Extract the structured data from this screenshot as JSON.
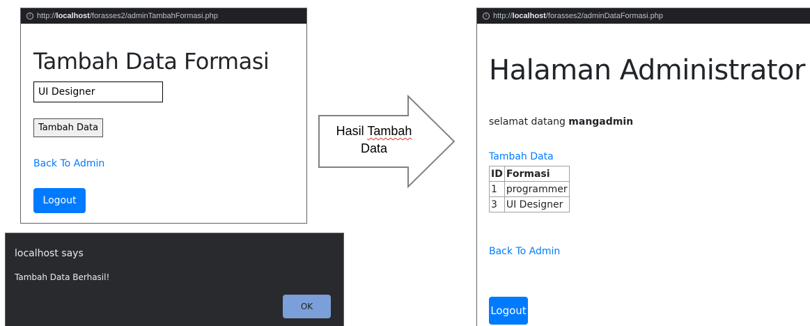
{
  "left_window": {
    "url_prefix": "http://",
    "url_host": "localhost",
    "url_path": "/forasses2/adminTambahFormasi.php",
    "heading": "Tambah Data Formasi",
    "input_value": "UI Designer",
    "submit_label": "Tambah Data",
    "back_link": "Back To Admin",
    "logout_label": "Logout"
  },
  "dialog": {
    "title": "localhost says",
    "message": "Tambah Data Berhasil!",
    "ok_label": "OK"
  },
  "arrow": {
    "line1_word1": "Hasil ",
    "line1_word2": "Tambah",
    "line2": "Data"
  },
  "right_window": {
    "url_prefix": "http://",
    "url_host": "localhost",
    "url_path": "/forasses2/adminDataFormasi.php",
    "heading": "Halaman Administrator",
    "welcome_text": "selamat datang ",
    "username": "mangadmin",
    "add_link": "Tambah Data",
    "table": {
      "headers": [
        "ID",
        "Formasi"
      ],
      "rows": [
        [
          "1",
          "programmer"
        ],
        [
          "3",
          "UI Designer"
        ]
      ]
    },
    "back_link": "Back To Admin",
    "logout_label": "Logout"
  },
  "colors": {
    "link_blue": "#007bff",
    "dialog_bg": "#292a2d",
    "ok_button": "#8ab4f8"
  }
}
